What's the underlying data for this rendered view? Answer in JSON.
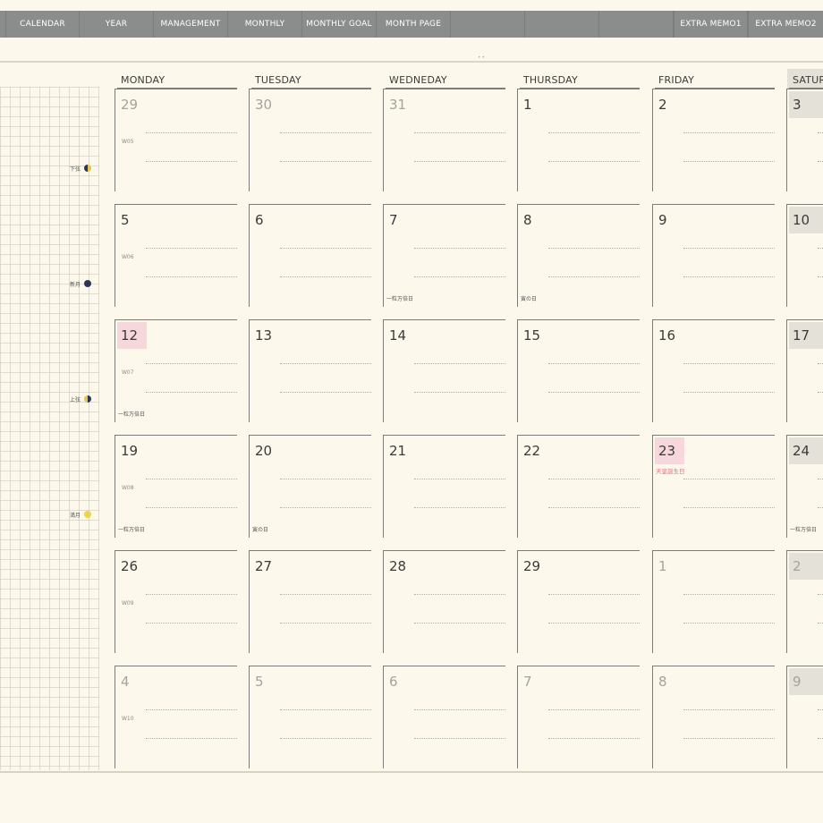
{
  "tabs": {
    "left": [
      "CALENDAR",
      "YEAR",
      "MANAGEMENT",
      "MONTHLY",
      "MONTHLY GOAL",
      "MONTH PAGE"
    ],
    "right": [
      "EXTRA MEMO1",
      "EXTRA MEMO2"
    ]
  },
  "days": [
    "MONDAY",
    "TUESDAY",
    "WEDNEDAY",
    "THURSDAY",
    "FRIDAY",
    "SATUR"
  ],
  "moons": [
    {
      "label": "下弦",
      "phase": "last-quarter"
    },
    {
      "label": "新月",
      "phase": "new"
    },
    {
      "label": "上弦",
      "phase": "first-quarter"
    },
    {
      "label": "満月",
      "phase": "full"
    }
  ],
  "weeks": [
    {
      "label": "W05",
      "days": [
        {
          "n": "29",
          "muted": true
        },
        {
          "n": "30",
          "muted": true
        },
        {
          "n": "31",
          "muted": true
        },
        {
          "n": "1"
        },
        {
          "n": "2"
        },
        {
          "n": "3",
          "hl": "grey"
        }
      ]
    },
    {
      "label": "W06",
      "days": [
        {
          "n": "5"
        },
        {
          "n": "6"
        },
        {
          "n": "7",
          "note": "一粒万倍日"
        },
        {
          "n": "8",
          "note": "寅の日"
        },
        {
          "n": "9"
        },
        {
          "n": "10",
          "hl": "grey"
        }
      ]
    },
    {
      "label": "W07",
      "days": [
        {
          "n": "12",
          "hl": "pink",
          "note": "一粒万倍日"
        },
        {
          "n": "13"
        },
        {
          "n": "14"
        },
        {
          "n": "15"
        },
        {
          "n": "16"
        },
        {
          "n": "17",
          "hl": "grey"
        }
      ]
    },
    {
      "label": "W08",
      "days": [
        {
          "n": "19",
          "note": "一粒万倍日"
        },
        {
          "n": "20",
          "note": "寅の日"
        },
        {
          "n": "21"
        },
        {
          "n": "22"
        },
        {
          "n": "23",
          "hl": "pink",
          "holiday": "天皇誕生日"
        },
        {
          "n": "24",
          "hl": "grey",
          "note": "一粒万倍日"
        }
      ]
    },
    {
      "label": "W09",
      "days": [
        {
          "n": "26"
        },
        {
          "n": "27"
        },
        {
          "n": "28"
        },
        {
          "n": "29"
        },
        {
          "n": "1",
          "muted": true
        },
        {
          "n": "2",
          "muted": true,
          "hl": "grey"
        }
      ]
    },
    {
      "label": "W10",
      "days": [
        {
          "n": "4",
          "muted": true
        },
        {
          "n": "5",
          "muted": true
        },
        {
          "n": "6",
          "muted": true
        },
        {
          "n": "7",
          "muted": true
        },
        {
          "n": "8",
          "muted": true
        },
        {
          "n": "9",
          "muted": true,
          "hl": "grey"
        }
      ]
    }
  ],
  "colors": {
    "holiday": "#d7707f",
    "today_highlight": "#f6d8dc",
    "weekend_highlight": "#e4e1d8",
    "tab_bar": "#8a8d8b"
  }
}
